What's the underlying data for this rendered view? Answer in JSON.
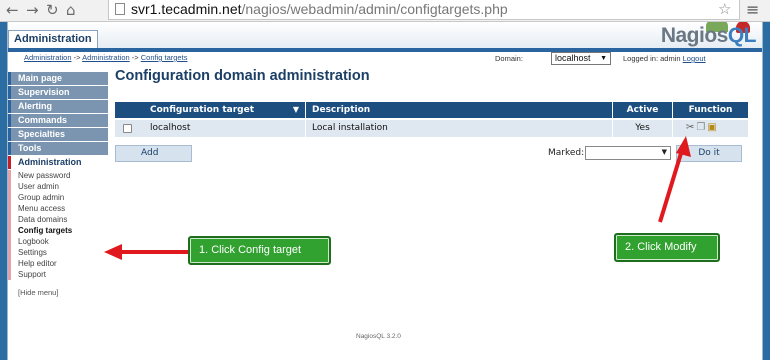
{
  "browser": {
    "url_host": "svr1.tecadmin.net",
    "url_path": "/nagios/webadmin/admin/configtargets.php"
  },
  "header": {
    "tab_label": "Administration",
    "logo_text": "Nagios",
    "logo_accent": "QL"
  },
  "infobar": {
    "breadcrumb_1": "Administration",
    "breadcrumb_sep_1": " -> ",
    "breadcrumb_2": "Administration",
    "breadcrumb_sep_2": " -> ",
    "breadcrumb_3": "Config targets",
    "domain_label": "Domain:",
    "domain_value": "localhost",
    "login_prefix": "Logged in: admin ",
    "logout_label": "Logout"
  },
  "sidebar": {
    "items": [
      {
        "label": "Main page"
      },
      {
        "label": "Supervision"
      },
      {
        "label": "Alerting"
      },
      {
        "label": "Commands"
      },
      {
        "label": "Specialties"
      },
      {
        "label": "Tools"
      },
      {
        "label": "Administration"
      }
    ],
    "subitems": [
      {
        "label": "New password"
      },
      {
        "label": "User admin"
      },
      {
        "label": "Group admin"
      },
      {
        "label": "Menu access"
      },
      {
        "label": "Data domains"
      },
      {
        "label": "Config targets"
      },
      {
        "label": "Logbook"
      },
      {
        "label": "Settings"
      },
      {
        "label": "Help editor"
      },
      {
        "label": "Support"
      }
    ],
    "hide_menu": "[Hide menu]"
  },
  "main": {
    "title": "Configuration domain administration",
    "columns": {
      "target": "Configuration target",
      "description": "Description",
      "active": "Active",
      "function": "Function"
    },
    "rows": [
      {
        "target": "localhost",
        "description": "Local installation",
        "active": "Yes"
      }
    ],
    "add_label": "Add",
    "marked_label": "Marked:",
    "doit_label": "Do it",
    "version": "NagiosQL 3.2.0"
  },
  "annotations": {
    "step1": "1. Click Config target",
    "step2": "2. Click Modify",
    "arrow_color": "#e0191e",
    "callout_color": "#31a12f"
  },
  "icons": [
    "back-icon",
    "forward-icon",
    "reload-icon",
    "home-icon",
    "page-icon",
    "star-icon",
    "menu-icon",
    "modify-icon",
    "copy-icon",
    "delete-icon",
    "dropdown-arrow-icon"
  ]
}
